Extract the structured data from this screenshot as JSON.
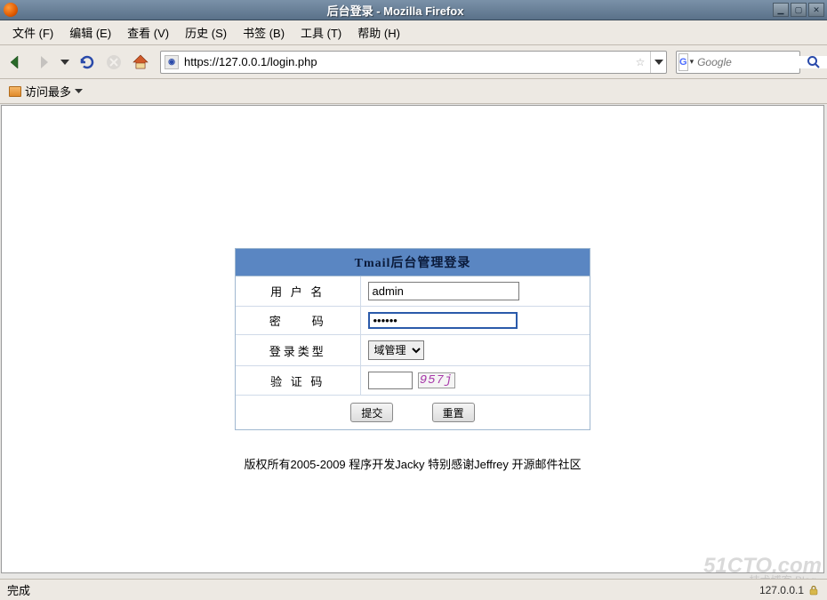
{
  "window": {
    "title": "后台登录 - Mozilla Firefox"
  },
  "menubar": {
    "file": "文件 (F)",
    "edit": "编辑 (E)",
    "view": "查看 (V)",
    "history": "历史 (S)",
    "bookmarks": "书签 (B)",
    "tools": "工具 (T)",
    "help": "帮助 (H)"
  },
  "urlbar": {
    "value": "https://127.0.0.1/login.php"
  },
  "searchbar": {
    "engine": "G",
    "placeholder": "Google"
  },
  "bookmarkbar": {
    "most_visited": "访问最多"
  },
  "login": {
    "header": "Tmail后台管理登录",
    "labels": {
      "username": "用 户 名",
      "password": "密　　码",
      "type": "登录类型",
      "captcha": "验 证 码"
    },
    "values": {
      "username": "admin",
      "password": "••••••",
      "type_option": "域管理",
      "captcha_text": "957j"
    },
    "buttons": {
      "submit": "提交",
      "reset": "重置"
    }
  },
  "footer": "版权所有2005-2009 程序开发Jacky 特别感谢Jeffrey 开源邮件社区",
  "statusbar": {
    "status": "完成",
    "host": "127.0.0.1"
  },
  "watermark": {
    "main": "51CTO.com",
    "sub": "技术博客  Blog"
  }
}
